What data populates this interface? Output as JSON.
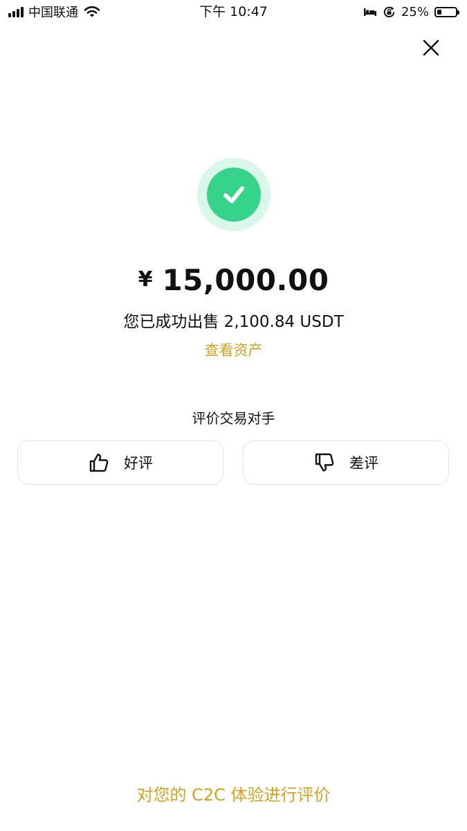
{
  "status_bar": {
    "carrier": "中国联通",
    "time": "下午 10:47",
    "battery_percent": "25%",
    "battery_level": 0.25,
    "icons": [
      "signal-icon",
      "wifi-icon",
      "bed-icon",
      "rotation-lock-icon",
      "battery-icon"
    ]
  },
  "header": {
    "close_icon": "close-icon"
  },
  "result": {
    "status_icon": "check-icon",
    "currency_symbol": "¥",
    "amount": "15,000.00",
    "sold_text": "您已成功出售 2,100.84 USDT",
    "view_assets_label": "查看资产"
  },
  "rating": {
    "title": "评价交易对手",
    "good_label": "好评",
    "good_icon": "thumbs-up-icon",
    "bad_label": "差评",
    "bad_icon": "thumbs-down-icon"
  },
  "footer": {
    "feedback_link": "对您的 C2C 体验进行评价"
  },
  "colors": {
    "accent_gold": "#d4a21f",
    "success_green": "#36d38a",
    "success_halo": "#daf8ea",
    "button_border": "#e6e6e6"
  }
}
